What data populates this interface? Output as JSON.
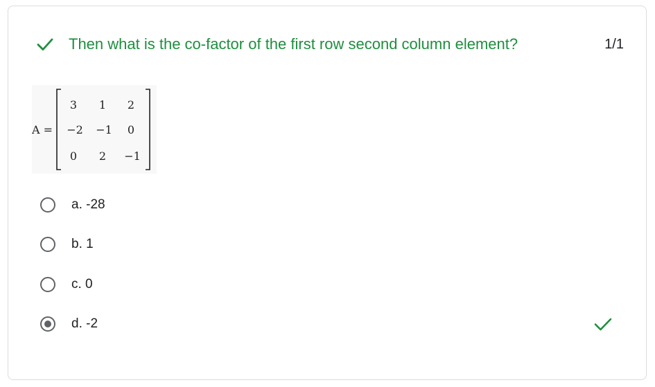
{
  "question": {
    "text": "Then what is the co-factor of the first row second column element?",
    "score": "1/1",
    "status_icon": "check-icon",
    "status_color": "#1e8e3e"
  },
  "matrix": {
    "label": "A =",
    "rows": [
      [
        "3",
        "1",
        "2"
      ],
      [
        "−2",
        "−1",
        "0"
      ],
      [
        "0",
        "2",
        "−1"
      ]
    ]
  },
  "options": [
    {
      "label": "a. -28",
      "selected": false
    },
    {
      "label": "b. 1",
      "selected": false
    },
    {
      "label": "c. 0",
      "selected": false
    },
    {
      "label": "d. -2",
      "selected": true,
      "correct": true
    }
  ]
}
